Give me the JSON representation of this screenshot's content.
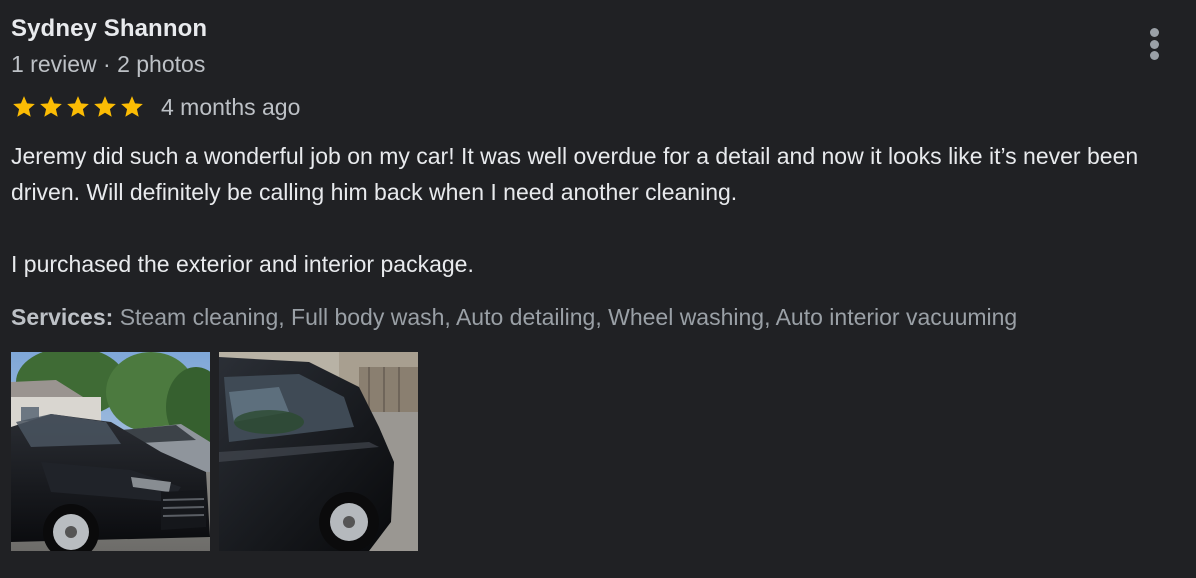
{
  "review": {
    "reviewer_name": "Sydney Shannon",
    "reviewer_meta": "1 review · 2 photos",
    "rating": 5,
    "rating_max": 5,
    "date": "4 months ago",
    "text": "Jeremy did such a wonderful job on my car! It was well overdue for a detail and now it looks like it’s never been driven. Will definitely be calling him back when I need another cleaning.\n\nI purchased the exterior and interior package.",
    "services_label": "Services:",
    "services_value": "Steam cleaning, Full body wash, Auto detailing, Wheel washing, Auto interior vacuuming",
    "photos": [
      {
        "icon": "car-front-photo"
      },
      {
        "icon": "car-side-photo"
      }
    ]
  },
  "colors": {
    "background": "#202124",
    "star": "#fbbc04",
    "text_primary": "#e8eaed",
    "text_secondary": "#bdc1c6",
    "text_muted": "#9aa0a6"
  },
  "menu": {
    "icon": "more-vert-icon"
  }
}
